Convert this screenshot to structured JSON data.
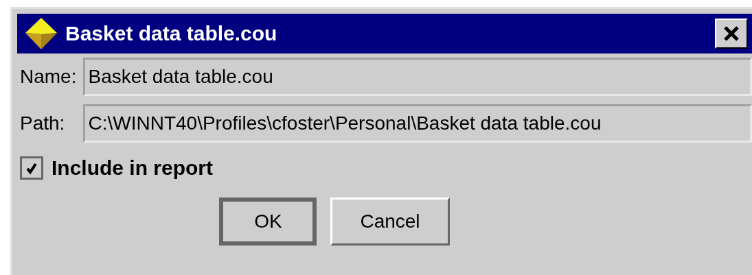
{
  "window": {
    "title": "Basket data table.cou"
  },
  "fields": [
    {
      "label": "Name:",
      "value": "Basket data table.cou"
    },
    {
      "label": "Path:",
      "value": "C:\\WINNT40\\Profiles\\cfoster\\Personal\\Basket data table.cou"
    }
  ],
  "checkbox": {
    "label": "Include in report",
    "checked": true
  },
  "buttons": [
    {
      "label": "OK",
      "default": true
    },
    {
      "label": "Cancel",
      "default": false
    }
  ]
}
